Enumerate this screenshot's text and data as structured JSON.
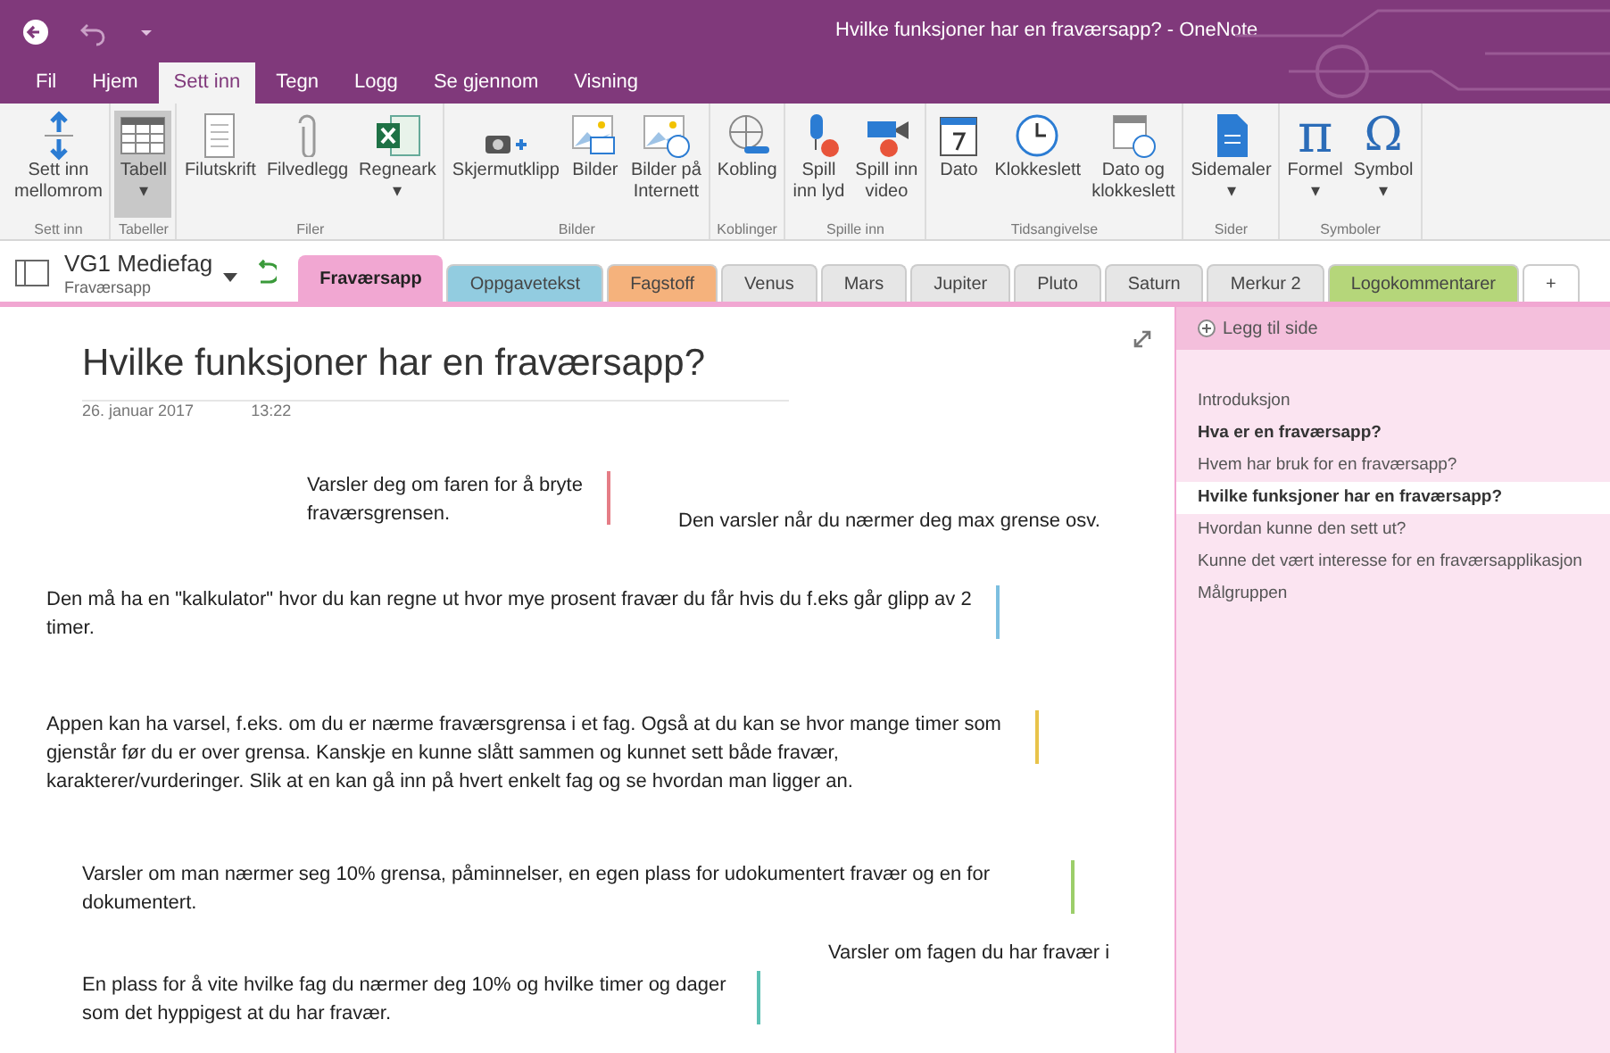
{
  "window": {
    "title": "Hvilke funksjoner har en fraværsapp? - OneNote"
  },
  "menu_tabs": [
    {
      "label": "Fil",
      "selected": false
    },
    {
      "label": "Hjem",
      "selected": false
    },
    {
      "label": "Sett inn",
      "selected": true
    },
    {
      "label": "Tegn",
      "selected": false
    },
    {
      "label": "Logg",
      "selected": false
    },
    {
      "label": "Se gjennom",
      "selected": false
    },
    {
      "label": "Visning",
      "selected": false
    }
  ],
  "ribbon_groups": [
    {
      "label": "Sett inn",
      "buttons": [
        {
          "kind": "space",
          "lines": [
            "Sett inn",
            "mellomrom"
          ],
          "selected": false
        }
      ]
    },
    {
      "label": "Tabeller",
      "buttons": [
        {
          "kind": "table",
          "lines": [
            "Tabell",
            "▾"
          ],
          "selected": true
        }
      ]
    },
    {
      "label": "Filer",
      "buttons": [
        {
          "kind": "printout",
          "lines": [
            "Filutskrift"
          ],
          "selected": false
        },
        {
          "kind": "attach",
          "lines": [
            "Filvedlegg"
          ],
          "selected": false
        },
        {
          "kind": "excel",
          "lines": [
            "Regneark",
            "▾"
          ],
          "selected": false
        }
      ]
    },
    {
      "label": "Bilder",
      "buttons": [
        {
          "kind": "camera",
          "lines": [
            "Skjermutklipp"
          ],
          "selected": false
        },
        {
          "kind": "image",
          "lines": [
            "Bilder"
          ],
          "selected": false
        },
        {
          "kind": "webimage",
          "lines": [
            "Bilder på",
            "Internett"
          ],
          "selected": false
        }
      ]
    },
    {
      "label": "Koblinger",
      "buttons": [
        {
          "kind": "link",
          "lines": [
            "Kobling"
          ],
          "selected": false
        }
      ]
    },
    {
      "label": "Spille inn",
      "buttons": [
        {
          "kind": "mic",
          "lines": [
            "Spill",
            "inn lyd"
          ],
          "selected": false
        },
        {
          "kind": "video",
          "lines": [
            "Spill inn",
            "video"
          ],
          "selected": false
        }
      ]
    },
    {
      "label": "Tidsangivelse",
      "buttons": [
        {
          "kind": "date",
          "lines": [
            "Dato"
          ],
          "selected": false
        },
        {
          "kind": "clock",
          "lines": [
            "Klokkeslett"
          ],
          "selected": false
        },
        {
          "kind": "datetime",
          "lines": [
            "Dato og",
            "klokkeslett"
          ],
          "selected": false
        }
      ]
    },
    {
      "label": "Sider",
      "buttons": [
        {
          "kind": "page",
          "lines": [
            "Sidemaler",
            "▾"
          ],
          "selected": false
        }
      ]
    },
    {
      "label": "Symboler",
      "buttons": [
        {
          "kind": "pi",
          "glyph": "π",
          "lines": [
            "Formel",
            "▾"
          ],
          "selected": false
        },
        {
          "kind": "omega",
          "glyph": "Ω",
          "lines": [
            "Symbol",
            "▾"
          ],
          "selected": false
        }
      ]
    }
  ],
  "notebook": {
    "name": "VG1 Mediefag",
    "section": "Fraværsapp"
  },
  "section_tabs": [
    {
      "label": "Fraværsapp",
      "selected": true,
      "color": "#f1a7d2"
    },
    {
      "label": "Oppgavetekst",
      "selected": false,
      "color": "#92cce0"
    },
    {
      "label": "Fagstoff",
      "selected": false,
      "color": "#f5b27c"
    },
    {
      "label": "Venus",
      "selected": false,
      "color": "#e6e6e6"
    },
    {
      "label": "Mars",
      "selected": false,
      "color": "#e6e6e6"
    },
    {
      "label": "Jupiter",
      "selected": false,
      "color": "#e6e6e6"
    },
    {
      "label": "Pluto",
      "selected": false,
      "color": "#e6e6e6"
    },
    {
      "label": "Saturn",
      "selected": false,
      "color": "#e6e6e6"
    },
    {
      "label": "Merkur 2",
      "selected": false,
      "color": "#e6e6e6"
    },
    {
      "label": "Logokommentarer",
      "selected": false,
      "color": "#b5d67a"
    },
    {
      "label": "+",
      "selected": false,
      "color": "#ffffff"
    }
  ],
  "page": {
    "title": "Hvilke funksjoner har en fraværsapp?",
    "date": "26. januar 2017",
    "time": "13:22",
    "notes": [
      {
        "text": "Varsler deg om faren for å bryte fraværsgrensen.",
        "color": "#e57d86"
      },
      {
        "text": "Den varsler når du nærmer deg max grense osv."
      },
      {
        "text": "Den må ha en \"kalkulator\" hvor du kan regne ut hvor mye prosent fravær du får hvis du f.eks går glipp av 2 timer.",
        "color": "#7cbfe0"
      },
      {
        "text": "Appen kan ha varsel, f.eks. om du er nærme fraværsgrensa i et fag. Også at du kan se hvor mange timer som gjenstår før du er over grensa. Kanskje en kunne slått sammen og kunnet sett både fravær, karakterer/vurderinger. Slik at en kan gå inn på hvert enkelt fag og se hvordan man ligger an.",
        "color": "#e8c34a"
      },
      {
        "text": "Varsler om man nærmer seg 10% grensa, påminnelser, en egen plass for udokumentert fravær og en for dokumentert.",
        "color": "#9cce6a"
      },
      {
        "text": "Varsler om fagen du har fravær i"
      },
      {
        "text": "En plass for å vite hvilke fag du nærmer deg 10% og hvilke timer og dager som det hyppigest at du har fravær.",
        "color": "#5cc0b4"
      }
    ]
  },
  "sidebar": {
    "add_page": "Legg til side",
    "pages": [
      {
        "label": "Introduksjon",
        "bold": false,
        "selected": false
      },
      {
        "label": "Hva er en fraværsapp?",
        "bold": true,
        "selected": false
      },
      {
        "label": "Hvem har bruk for en fraværsapp?",
        "bold": false,
        "selected": false
      },
      {
        "label": "Hvilke funksjoner har en fraværsapp?",
        "bold": true,
        "selected": true
      },
      {
        "label": "Hvordan kunne den sett ut?",
        "bold": false,
        "selected": false
      },
      {
        "label": "Kunne det vært interesse for en fraværsapplikasjon",
        "bold": false,
        "selected": false
      },
      {
        "label": "Målgruppen",
        "bold": false,
        "selected": false
      }
    ]
  }
}
